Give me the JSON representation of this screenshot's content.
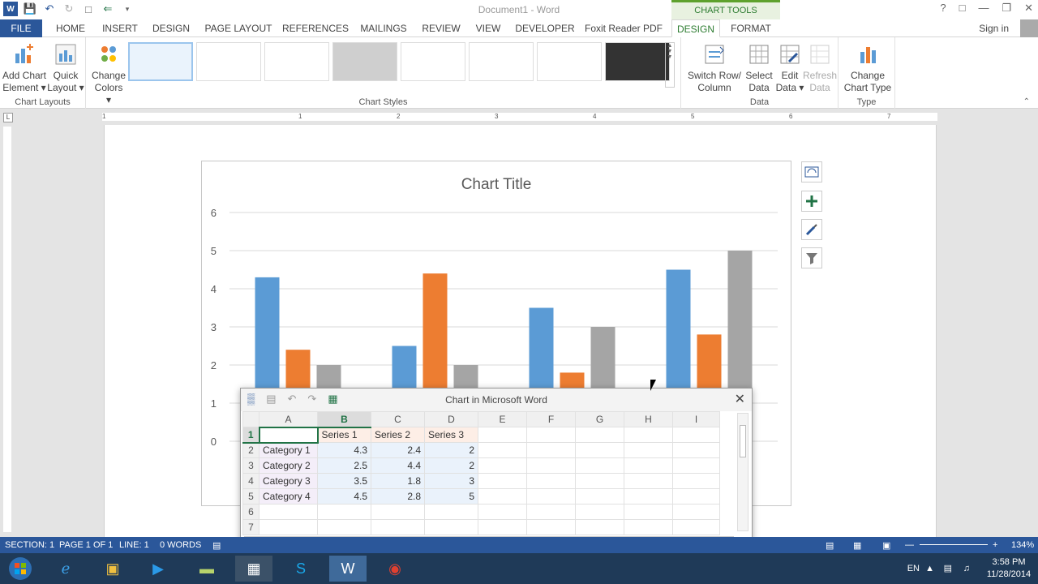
{
  "window": {
    "title": "Document1 - Word"
  },
  "chart_tools_header": "CHART TOOLS",
  "tabs": [
    "FILE",
    "HOME",
    "INSERT",
    "DESIGN",
    "PAGE LAYOUT",
    "REFERENCES",
    "MAILINGS",
    "REVIEW",
    "VIEW",
    "DEVELOPER",
    "Foxit Reader PDF",
    "DESIGN",
    "FORMAT"
  ],
  "signin": "Sign in",
  "ribbon": {
    "add_chart": [
      "Add Chart",
      "Element"
    ],
    "quick_layout": [
      "Quick",
      "Layout"
    ],
    "change_colors": [
      "Change",
      "Colors"
    ],
    "switch_row": [
      "Switch Row/",
      "Column"
    ],
    "select_data": [
      "Select",
      "Data"
    ],
    "edit_data": [
      "Edit",
      "Data"
    ],
    "refresh_data": [
      "Refresh",
      "Data"
    ],
    "change_chart_type": [
      "Change",
      "Chart Type"
    ],
    "groups": {
      "chart_layouts": "Chart Layouts",
      "chart_styles": "Chart Styles",
      "data": "Data",
      "type": "Type"
    }
  },
  "ruler": {
    "numbers": [
      "1",
      "1",
      "2",
      "3",
      "4",
      "5",
      "6",
      "7"
    ]
  },
  "chart_data": {
    "type": "bar",
    "title": "Chart Title",
    "categories": [
      "Category 1",
      "Category 2",
      "Category 3",
      "Category 4"
    ],
    "series": [
      {
        "name": "Series 1",
        "values": [
          4.3,
          2.5,
          3.5,
          4.5
        ],
        "color": "#5b9bd5"
      },
      {
        "name": "Series 2",
        "values": [
          2.4,
          4.4,
          1.8,
          2.8
        ],
        "color": "#ed7d31"
      },
      {
        "name": "Series 3",
        "values": [
          2,
          2,
          3,
          5
        ],
        "color": "#a5a5a5"
      }
    ],
    "ylim": [
      0,
      6
    ],
    "yticks": [
      "0",
      "1",
      "2",
      "3",
      "4",
      "5",
      "6"
    ],
    "grid": true
  },
  "popup": {
    "title": "Chart in Microsoft Word",
    "columns": [
      "A",
      "B",
      "C",
      "D",
      "E",
      "F",
      "G",
      "H",
      "I"
    ],
    "rows": [
      "1",
      "2",
      "3",
      "4",
      "5",
      "6",
      "7"
    ],
    "header_row": [
      "",
      "Series 1",
      "Series 2",
      "Series 3"
    ],
    "data_rows": [
      [
        "Category 1",
        "4.3",
        "2.4",
        "2"
      ],
      [
        "Category 2",
        "2.5",
        "4.4",
        "2"
      ],
      [
        "Category 3",
        "3.5",
        "1.8",
        "3"
      ],
      [
        "Category 4",
        "4.5",
        "2.8",
        "5"
      ]
    ]
  },
  "status": {
    "section": "SECTION: 1",
    "page": "PAGE 1 OF 1",
    "line": "LINE: 1",
    "words": "0 WORDS",
    "zoom": "134%"
  },
  "tray": {
    "lang": "EN",
    "time": "3:58 PM",
    "date": "11/28/2014"
  }
}
